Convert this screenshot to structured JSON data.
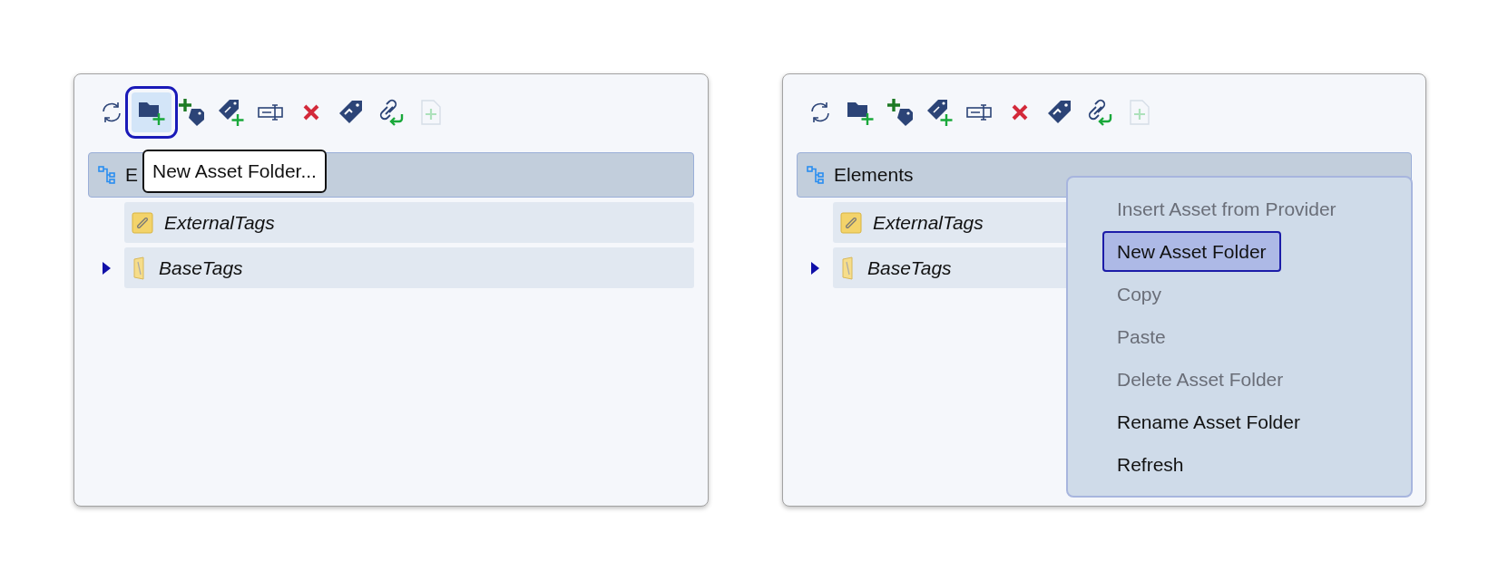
{
  "panels": [
    {
      "toolbar": [
        {
          "kind": "refresh",
          "selected": false,
          "disabled": false
        },
        {
          "kind": "new-folder",
          "selected": true,
          "disabled": false
        },
        {
          "kind": "new-tag",
          "selected": false,
          "disabled": false
        },
        {
          "kind": "new-link-tag",
          "selected": false,
          "disabled": false
        },
        {
          "kind": "rename",
          "selected": false,
          "disabled": false
        },
        {
          "kind": "delete",
          "selected": false,
          "disabled": false
        },
        {
          "kind": "tag-arrow",
          "selected": false,
          "disabled": false
        },
        {
          "kind": "link-arrow",
          "selected": false,
          "disabled": false
        },
        {
          "kind": "new-file",
          "selected": false,
          "disabled": true
        }
      ],
      "tree": {
        "label": "E",
        "selected": true,
        "children": [
          {
            "label": "ExternalTags",
            "kind": "link-folder",
            "expandable": false
          },
          {
            "label": "BaseTags",
            "kind": "folder",
            "expandable": true
          }
        ]
      },
      "tooltip": "New Asset Folder..."
    },
    {
      "toolbar": [
        {
          "kind": "refresh",
          "selected": false,
          "disabled": false
        },
        {
          "kind": "new-folder",
          "selected": false,
          "disabled": false
        },
        {
          "kind": "new-tag",
          "selected": false,
          "disabled": false
        },
        {
          "kind": "new-link-tag",
          "selected": false,
          "disabled": false
        },
        {
          "kind": "rename",
          "selected": false,
          "disabled": false
        },
        {
          "kind": "delete",
          "selected": false,
          "disabled": false
        },
        {
          "kind": "tag-arrow",
          "selected": false,
          "disabled": false
        },
        {
          "kind": "link-arrow",
          "selected": false,
          "disabled": false
        },
        {
          "kind": "new-file",
          "selected": false,
          "disabled": true
        }
      ],
      "tree": {
        "label": "Elements",
        "selected": true,
        "children": [
          {
            "label": "ExternalTags",
            "kind": "link-folder",
            "expandable": false
          },
          {
            "label": "BaseTags",
            "kind": "folder",
            "expandable": true
          }
        ]
      },
      "context_menu": [
        {
          "label": "Insert Asset from Provider",
          "disabled": true,
          "selected": false
        },
        {
          "label": "New Asset Folder",
          "disabled": false,
          "selected": true
        },
        {
          "label": "Copy",
          "disabled": true,
          "selected": false
        },
        {
          "label": "Paste",
          "disabled": true,
          "selected": false
        },
        {
          "label": "Delete Asset Folder",
          "disabled": true,
          "selected": false
        },
        {
          "label": "Rename Asset Folder",
          "disabled": false,
          "selected": false
        },
        {
          "label": "Refresh",
          "disabled": false,
          "selected": false
        }
      ]
    }
  ]
}
